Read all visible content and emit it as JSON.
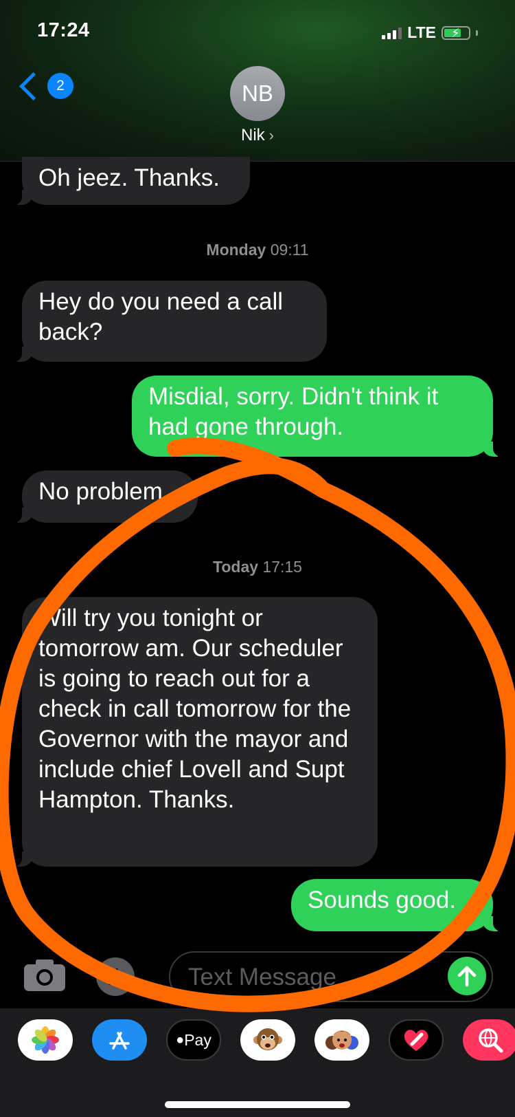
{
  "status_bar": {
    "time": "17:24",
    "network": "LTE"
  },
  "nav": {
    "unread_count": "2",
    "avatar_initials": "NB",
    "contact_name": "Nik",
    "contact_chevron": "›"
  },
  "messages": [
    {
      "text": "Oh jeez. Thanks.",
      "direction": "incoming"
    },
    {
      "text": "Hey do you need a call back?",
      "direction": "incoming"
    },
    {
      "text": "Misdial, sorry. Didn't think it had gone through.",
      "direction": "outgoing"
    },
    {
      "text": "No problem",
      "direction": "incoming"
    },
    {
      "text": "Will try you tonight or tomorrow am. Our scheduler is going to reach out for a check in call tomorrow for the Governor with the mayor and include chief Lovell and Supt Hampton. Thanks.",
      "direction": "incoming"
    },
    {
      "text": "Sounds good.",
      "direction": "outgoing"
    }
  ],
  "timestamps": [
    {
      "day": "Monday",
      "time": "09:11"
    },
    {
      "day": "Today",
      "time": "17:15"
    }
  ],
  "composer": {
    "placeholder": "Text Message"
  },
  "app_drawer": {
    "apple_pay_label": "Pay",
    "apps": [
      "photos-icon",
      "app-store-icon",
      "apple-pay-icon",
      "animoji-icon",
      "memoji-icon",
      "digital-touch-icon",
      "web-search-icon"
    ]
  },
  "colors": {
    "incoming_bubble": "#262628",
    "outgoing_bubble": "#30d158",
    "accent_blue": "#0a84ff",
    "annotation": "#ff6a00"
  }
}
